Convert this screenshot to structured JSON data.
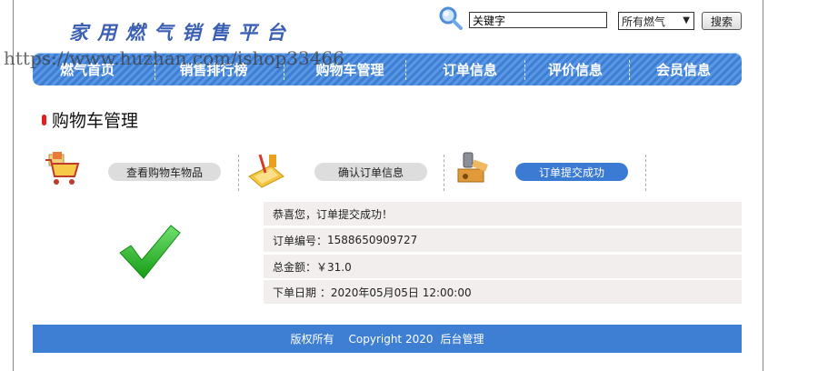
{
  "header": {
    "site_title": "家用燃气销售平台",
    "search_placeholder": "关键字",
    "search_value": "关键字",
    "category_selected": "所有燃气",
    "search_button": "搜索"
  },
  "watermark": "https://www.huzhan.com/ishop33466",
  "nav": {
    "items": [
      {
        "label": "燃气首页"
      },
      {
        "label": "销售排行榜"
      },
      {
        "label": "购物车管理"
      },
      {
        "label": "订单信息"
      },
      {
        "label": "评价信息"
      },
      {
        "label": "会员信息"
      }
    ]
  },
  "page": {
    "title": "购物车管理"
  },
  "steps": [
    {
      "label": "查看购物车物品",
      "icon": "shopping-cart-icon",
      "active": false
    },
    {
      "label": "确认订单信息",
      "icon": "calculator-icon",
      "active": false
    },
    {
      "label": "订单提交成功",
      "icon": "tools-icon",
      "active": true
    }
  ],
  "order": {
    "success_message": "恭喜您，订单提交成功！",
    "number_label": "订单编号：",
    "number_value": "1588650909727",
    "total_label": "总金额：",
    "total_value": "￥31.0",
    "date_label": "下单日期 ：",
    "date_value": "2020年05月05日 12:00:00"
  },
  "footer": {
    "rights": "版权所有",
    "copyright": "Copyright 2020",
    "admin_link": "后台管理"
  },
  "colors": {
    "nav_blue": "#3e7fd4",
    "active_step": "#3b7bd4",
    "heading_bullet": "#e02020",
    "row_bg": "#f3eeee",
    "check_green": "#2db52d"
  }
}
